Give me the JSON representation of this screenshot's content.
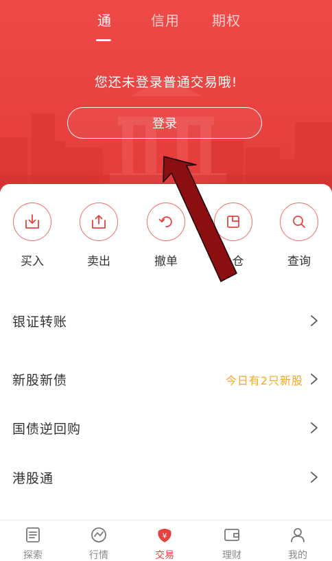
{
  "header": {
    "tabs": [
      {
        "label": "通",
        "active": true
      },
      {
        "label": "信用",
        "active": false
      },
      {
        "label": "期权",
        "active": false
      }
    ],
    "login_prompt": "您还未登录普通交易哦!",
    "login_button": "登录"
  },
  "actions": [
    {
      "label": "买入",
      "icon": "buy-icon"
    },
    {
      "label": "卖出",
      "icon": "sell-icon"
    },
    {
      "label": "撤单",
      "icon": "cancel-order-icon"
    },
    {
      "label": "仓",
      "icon": "position-icon"
    },
    {
      "label": "查询",
      "icon": "search-icon"
    }
  ],
  "menu": [
    {
      "label": "银证转账",
      "hint": ""
    },
    {
      "label": "新股新债",
      "hint": "今日有2只新股"
    },
    {
      "label": "国债逆回购",
      "hint": ""
    },
    {
      "label": "港股通",
      "hint": ""
    }
  ],
  "bottom_nav": [
    {
      "label": "探索",
      "icon": "news-icon",
      "active": false
    },
    {
      "label": "行情",
      "icon": "market-icon",
      "active": false
    },
    {
      "label": "交易",
      "icon": "trade-icon",
      "active": true
    },
    {
      "label": "理财",
      "icon": "wallet-icon",
      "active": false
    },
    {
      "label": "我的",
      "icon": "profile-icon",
      "active": false
    }
  ],
  "colors": {
    "brand_red": "#e8413f",
    "hint_orange": "#f5a623",
    "icon_ring": "#ef6a66",
    "arrow_fill": "#8b0f10"
  }
}
